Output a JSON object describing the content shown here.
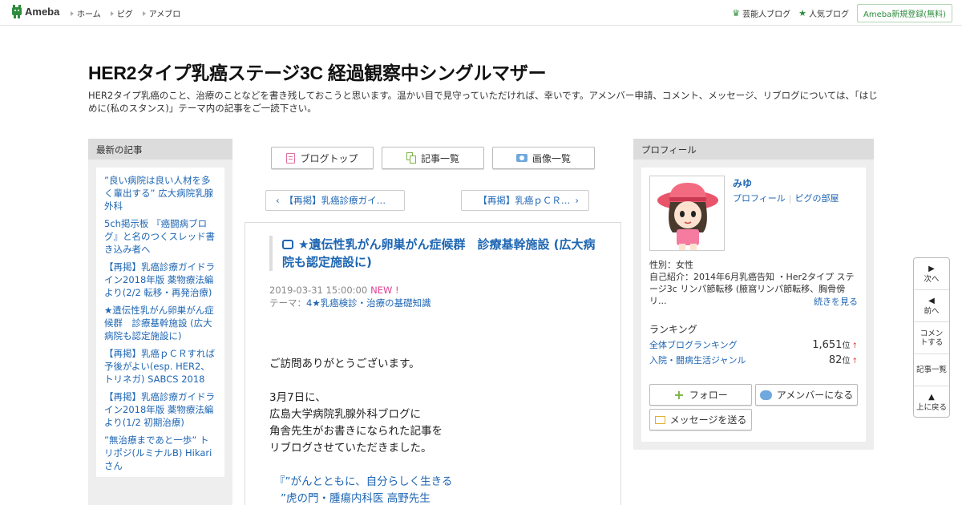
{
  "topbar": {
    "logo": "Ameba",
    "nav": [
      "ホーム",
      "ピグ",
      "アメブロ"
    ],
    "right": {
      "celeb": "芸能人ブログ",
      "popular": "人気ブログ",
      "signup": "Ameba新規登録(無料)"
    },
    "colors": {
      "accent": "#2d8c3c"
    }
  },
  "header": {
    "title": "HER2タイプ乳癌ステージ3C 経過観察中シングルマザー",
    "description": "HER2タイプ乳癌のこと、治療のことなどを書き残しておこうと思います。温かい目で見守っていただければ、幸いです。アメンバー申請、コメント、メッセージ、リブログについては、「はじめに(私のスタンス)」テーマ内の記事をご一読下さい。"
  },
  "left": {
    "heading": "最新の記事",
    "items": [
      "”良い病院は良い人材を多く輩出する” 広大病院乳腺外科",
      "5ch掲示板 『癌闘病ブログ』と名のつくスレッド書き込み者へ",
      "【再掲】乳癌診療ガイドライン2018年版 薬物療法編より(2/2 転移・再発治療)",
      "★遺伝性乳がん卵巣がん症候群　診療基幹施設 (広大病院も認定施設に)",
      "【再掲】乳癌ｐＣＲすれば予後がよい(esp. HER2、トリネガ) SABCS 2018",
      "【再掲】乳癌診療ガイドライン2018年版 薬物療法編より(1/2 初期治療)",
      "”無治療まであと一歩” トリポジ(ルミナルB) Hikariさん"
    ]
  },
  "center": {
    "nav": {
      "blog_top": "ブログトップ",
      "entries": "記事一覧",
      "images": "画像一覧"
    },
    "prev": "【再掲】乳癌診療ガイ…",
    "next": "【再掲】乳癌ｐＣＲ…",
    "article": {
      "title": "★遺伝性乳がん卵巣がん症候群　診療基幹施設 (広大病院も認定施設に)",
      "date": "2019-03-31 15:00:00",
      "new_badge": "NEW !",
      "theme_label": "テーマ：",
      "theme": "4★乳癌検診・治療の基礎知識",
      "body": [
        "ご訪問ありがとうございます。",
        "",
        "3月7日に、",
        "広島大学病院乳腺外科ブログに",
        "角舎先生がお書きになられた記事を",
        "リブログさせていただきました。",
        ""
      ],
      "quote_line1": "『”がんとともに、自分らしく生きる",
      "quote_line2": "”虎の門・腫瘍内科医 高野先生"
    }
  },
  "right": {
    "heading": "プロフィール",
    "name": "みゆ",
    "link_profile": "プロフィール",
    "link_pig": "ピグの部屋",
    "gender": "性別：女性",
    "intro": "自己紹介：2014年6月乳癌告知 ・Her2タイプ ステージ3c リンパ節転移 (腋窩リンパ節転移、胸骨傍リ...",
    "more": "続きを見る",
    "ranking_heading": "ランキング",
    "ranks": [
      {
        "label": "全体ブログランキング",
        "value": "1,651",
        "unit": "位",
        "arrow": "↑"
      },
      {
        "label": "入院・闘病生活ジャンル",
        "value": "82",
        "unit": "位",
        "arrow": "↑"
      }
    ],
    "follow": "フォロー",
    "amember": "アメンバーになる",
    "message": "メッセージを送る"
  },
  "sidenav": {
    "next": "次へ",
    "prev": "前へ",
    "comment": "コメントする",
    "entries": "記事一覧",
    "top": "上に戻る"
  }
}
